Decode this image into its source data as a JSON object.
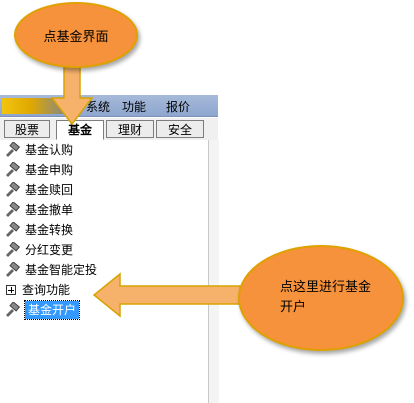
{
  "menubar": {
    "items": [
      "系统",
      "功能",
      "报价"
    ]
  },
  "tabs": [
    {
      "label": "股票",
      "active": false
    },
    {
      "label": "基金",
      "active": true
    },
    {
      "label": "理财",
      "active": false
    },
    {
      "label": "安全",
      "active": false
    }
  ],
  "tree": [
    {
      "label": "基金认购",
      "type": "item"
    },
    {
      "label": "基金申购",
      "type": "item"
    },
    {
      "label": "基金赎回",
      "type": "item"
    },
    {
      "label": "基金撤单",
      "type": "item"
    },
    {
      "label": "基金转换",
      "type": "item"
    },
    {
      "label": "分红变更",
      "type": "item"
    },
    {
      "label": "基金智能定投",
      "type": "item"
    },
    {
      "label": "查询功能",
      "type": "group"
    },
    {
      "label": "基金开户",
      "type": "item",
      "selected": true
    }
  ],
  "callouts": {
    "top": "点基金界面",
    "right_line1": "点这里进行基金",
    "right_line2": "开户"
  },
  "colors": {
    "callout_fill": "#f6923b",
    "callout_border": "#e0a000",
    "arrow_fill": "#f6b26b",
    "selection": "#3399ff"
  }
}
